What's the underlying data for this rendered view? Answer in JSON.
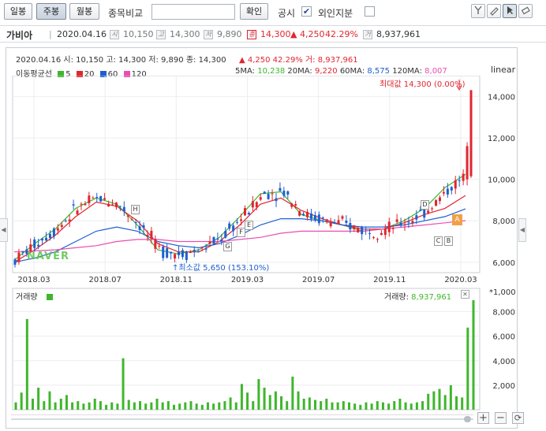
{
  "toolbar": {
    "daily": "일봉",
    "weekly": "주봉",
    "monthly": "월봉",
    "compare_label": "종목비교",
    "compare_input": "",
    "confirm": "확인",
    "disclosure": "공시",
    "disclosure_check": "✔",
    "foreign": "외인지분"
  },
  "info": {
    "name": "가비아",
    "date": "2020.04.16",
    "open_icon": "시",
    "open": "10,150",
    "high_icon": "고",
    "high": "14,300",
    "low_icon": "저",
    "low": "9,890",
    "close_icon": "종",
    "close": "14,300",
    "change": "▲ 4,250",
    "change_pct": "42.29%",
    "volume_icon": "거",
    "volume": "8,937,961"
  },
  "chart_header": {
    "line": "2020.04.16 시: 10,150 고: 14,300 저: 9,890 종: 14,300",
    "change": "▲ 4,250 42.29% 거: 8,937,961",
    "ma_label": "이동평균선",
    "ma": [
      {
        "period": "5",
        "color": "#3fb62c"
      },
      {
        "period": "20",
        "color": "#e0262f"
      },
      {
        "period": "60",
        "color": "#1e5fd0"
      },
      {
        "period": "120",
        "color": "#e94fb0"
      }
    ],
    "ma_values": {
      "ma5_label": "5MA:",
      "ma5": "10,238",
      "ma20_label": "20MA:",
      "ma20": "9,220",
      "ma60_label": "60MA:",
      "ma60": "8,575",
      "ma120_label": "120MA:",
      "ma120": "8,007"
    },
    "scale": "linear",
    "max_label": "최대값 14,300 (0.00%)",
    "min_label": "최소값 5,650 (153.10%)",
    "watermark": "NAVER",
    "marker_a": "A",
    "marker_b": "B",
    "marker_c": "C",
    "marker_d": "D",
    "marker_e": "E",
    "marker_f": "F",
    "marker_g": "G",
    "marker_h": "H"
  },
  "volume_header": {
    "label": "거래량",
    "value_label": "거래량:",
    "value": "8,937,961",
    "unit": "*1,000"
  },
  "colors": {
    "up": "#e0262f",
    "down": "#1e5fd0",
    "volume": "#3fb62c",
    "ma5": "#3fb62c",
    "ma20": "#e0262f",
    "ma60": "#1e5fd0",
    "ma120": "#e94fb0"
  },
  "chart_data": [
    {
      "type": "line",
      "x": [
        "2018.03",
        "2018.07",
        "2018.11",
        "2019.03",
        "2019.07",
        "2019.11",
        "2020.03"
      ],
      "y_ticks": [
        "14,000",
        "12,000",
        "10,000",
        "8,000",
        "6,000"
      ],
      "ylim": [
        5500,
        15000
      ],
      "series": [
        {
          "name": "5",
          "values": [
            6100,
            6900,
            7600,
            8600,
            9100,
            8800,
            7800,
            6600,
            6400,
            6600,
            7200,
            8200,
            9300,
            9400,
            8300,
            8000,
            7800,
            7500,
            7600,
            8000,
            8600,
            9600,
            10238
          ]
        },
        {
          "name": "20",
          "values": [
            6000,
            6600,
            7300,
            8200,
            8900,
            8700,
            8000,
            6900,
            6500,
            6500,
            7000,
            7800,
            8800,
            9100,
            8500,
            8100,
            7800,
            7600,
            7600,
            7900,
            8300,
            8600,
            9220
          ]
        },
        {
          "name": "60",
          "values": [
            6000,
            6200,
            6500,
            7000,
            7500,
            7700,
            7500,
            7000,
            6800,
            6700,
            6900,
            7300,
            7800,
            8100,
            8100,
            8000,
            7800,
            7700,
            7700,
            7800,
            8000,
            8200,
            8575
          ]
        },
        {
          "name": "120",
          "values": [
            6500,
            6550,
            6600,
            6700,
            6800,
            7000,
            7100,
            7100,
            7000,
            7000,
            7000,
            7100,
            7200,
            7400,
            7500,
            7500,
            7500,
            7500,
            7600,
            7700,
            7800,
            7900,
            8007
          ]
        }
      ]
    },
    {
      "type": "bar",
      "y_ticks": [
        "8,000",
        "6,000",
        "4,000",
        "2,000"
      ],
      "ylim": [
        0,
        9000
      ],
      "values": [
        600,
        1400,
        7400,
        900,
        1800,
        700,
        1500,
        600,
        900,
        1200,
        600,
        700,
        500,
        600,
        900,
        700,
        400,
        600,
        500,
        4200,
        800,
        600,
        700,
        500,
        600,
        900,
        600,
        700,
        400,
        500,
        600,
        700,
        500,
        400,
        600,
        500,
        600,
        700,
        1000,
        600,
        2100,
        1400,
        700,
        2500,
        1800,
        1200,
        1500,
        1100,
        700,
        2700,
        1500,
        900,
        1000,
        800,
        700,
        900,
        600,
        600,
        700,
        600,
        500,
        400,
        600,
        500,
        700,
        600,
        500,
        700,
        900,
        600,
        500,
        600,
        700,
        1300,
        1500,
        1700,
        1200,
        2000,
        1100,
        1000,
        6700,
        8938
      ]
    }
  ]
}
